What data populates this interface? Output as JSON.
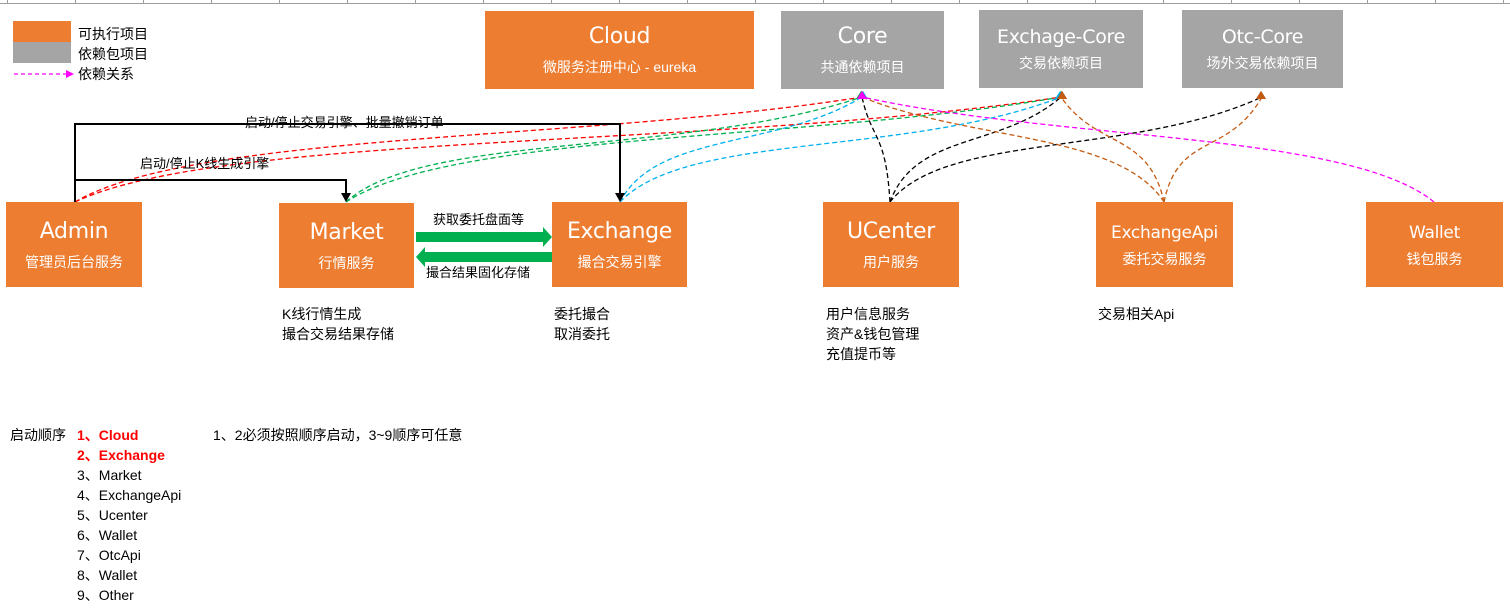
{
  "legend": [
    {
      "label": "可执行项目",
      "kind": "executable",
      "color": "#ed7d31"
    },
    {
      "label": "依赖包项目",
      "kind": "dependency",
      "color": "#a5a5a5"
    },
    {
      "label": "依赖关系",
      "kind": "relation",
      "color": "#ff00ff"
    }
  ],
  "colors": {
    "executable": "#ed7d31",
    "dependency": "#a5a5a5",
    "green_arrow": "#00b050",
    "highlight": "#ff0000"
  },
  "dependency_projects": [
    {
      "id": "core",
      "title": "Core",
      "subtitle": "共通依赖项目"
    },
    {
      "id": "exchange-core",
      "title": "Exchage-Core",
      "subtitle": "交易依赖项目"
    },
    {
      "id": "otc-core",
      "title": "Otc-Core",
      "subtitle": "场外交易依赖项目"
    }
  ],
  "cloud": {
    "title": "Cloud",
    "subtitle": "微服务注册中心 - eureka"
  },
  "services": [
    {
      "id": "admin",
      "title": "Admin",
      "subtitle": "管理员后台服务",
      "description": []
    },
    {
      "id": "market",
      "title": "Market",
      "subtitle": "行情服务",
      "description": [
        "K线行情生成",
        "撮合交易结果存储"
      ]
    },
    {
      "id": "exchange",
      "title": "Exchange",
      "subtitle": "撮合交易引擎",
      "description": [
        "委托撮合",
        "取消委托"
      ]
    },
    {
      "id": "ucenter",
      "title": "UCenter",
      "subtitle": "用户服务",
      "description": [
        "用户信息服务",
        "资产&钱包管理",
        "充值提币等"
      ]
    },
    {
      "id": "exchangeapi",
      "title": "ExchangeApi",
      "subtitle": "委托交易服务",
      "description": [
        "交易相关Api"
      ]
    },
    {
      "id": "wallet",
      "title": "Wallet",
      "subtitle": "钱包服务",
      "description": []
    }
  ],
  "control_links": [
    {
      "from": "admin",
      "to": "exchange",
      "label": "启动/停止交易引擎、批量撤销订单"
    },
    {
      "from": "admin",
      "to": "market",
      "label": "启动/停止K线生成引擎"
    }
  ],
  "data_links": [
    {
      "from": "market",
      "to": "exchange",
      "label": "获取委托盘面等"
    },
    {
      "from": "exchange",
      "to": "market",
      "label": "撮合结果固化存储"
    }
  ],
  "dependencies": [
    {
      "from": "admin",
      "to": "core",
      "color": "#ff0000"
    },
    {
      "from": "admin",
      "to": "exchange-core",
      "color": "#ff0000"
    },
    {
      "from": "market",
      "to": "core",
      "color": "#00b050"
    },
    {
      "from": "market",
      "to": "exchange-core",
      "color": "#00b050"
    },
    {
      "from": "exchange",
      "to": "core",
      "color": "#00b0f0"
    },
    {
      "from": "exchange",
      "to": "exchange-core",
      "color": "#00b0f0"
    },
    {
      "from": "ucenter",
      "to": "core",
      "color": "#000000"
    },
    {
      "from": "ucenter",
      "to": "exchange-core",
      "color": "#000000"
    },
    {
      "from": "ucenter",
      "to": "otc-core",
      "color": "#000000"
    },
    {
      "from": "exchangeapi",
      "to": "core",
      "color": "#c55a11"
    },
    {
      "from": "exchangeapi",
      "to": "exchange-core",
      "color": "#c55a11"
    },
    {
      "from": "exchangeapi",
      "to": "otc-core",
      "color": "#c55a11"
    },
    {
      "from": "wallet",
      "to": "core",
      "color": "#ff00ff"
    }
  ],
  "startup": {
    "heading": "启动顺序",
    "items": [
      {
        "label": "1、Cloud",
        "highlight": true
      },
      {
        "label": "2、Exchange",
        "highlight": true
      },
      {
        "label": "3、Market",
        "highlight": false
      },
      {
        "label": "4、ExchangeApi",
        "highlight": false
      },
      {
        "label": "5、Ucenter",
        "highlight": false
      },
      {
        "label": "6、Wallet",
        "highlight": false
      },
      {
        "label": "7、OtcApi",
        "highlight": false
      },
      {
        "label": "8、Wallet",
        "highlight": false
      },
      {
        "label": "9、Other",
        "highlight": false
      }
    ],
    "note": "1、2必须按照顺序启动，3~9顺序可任意"
  }
}
